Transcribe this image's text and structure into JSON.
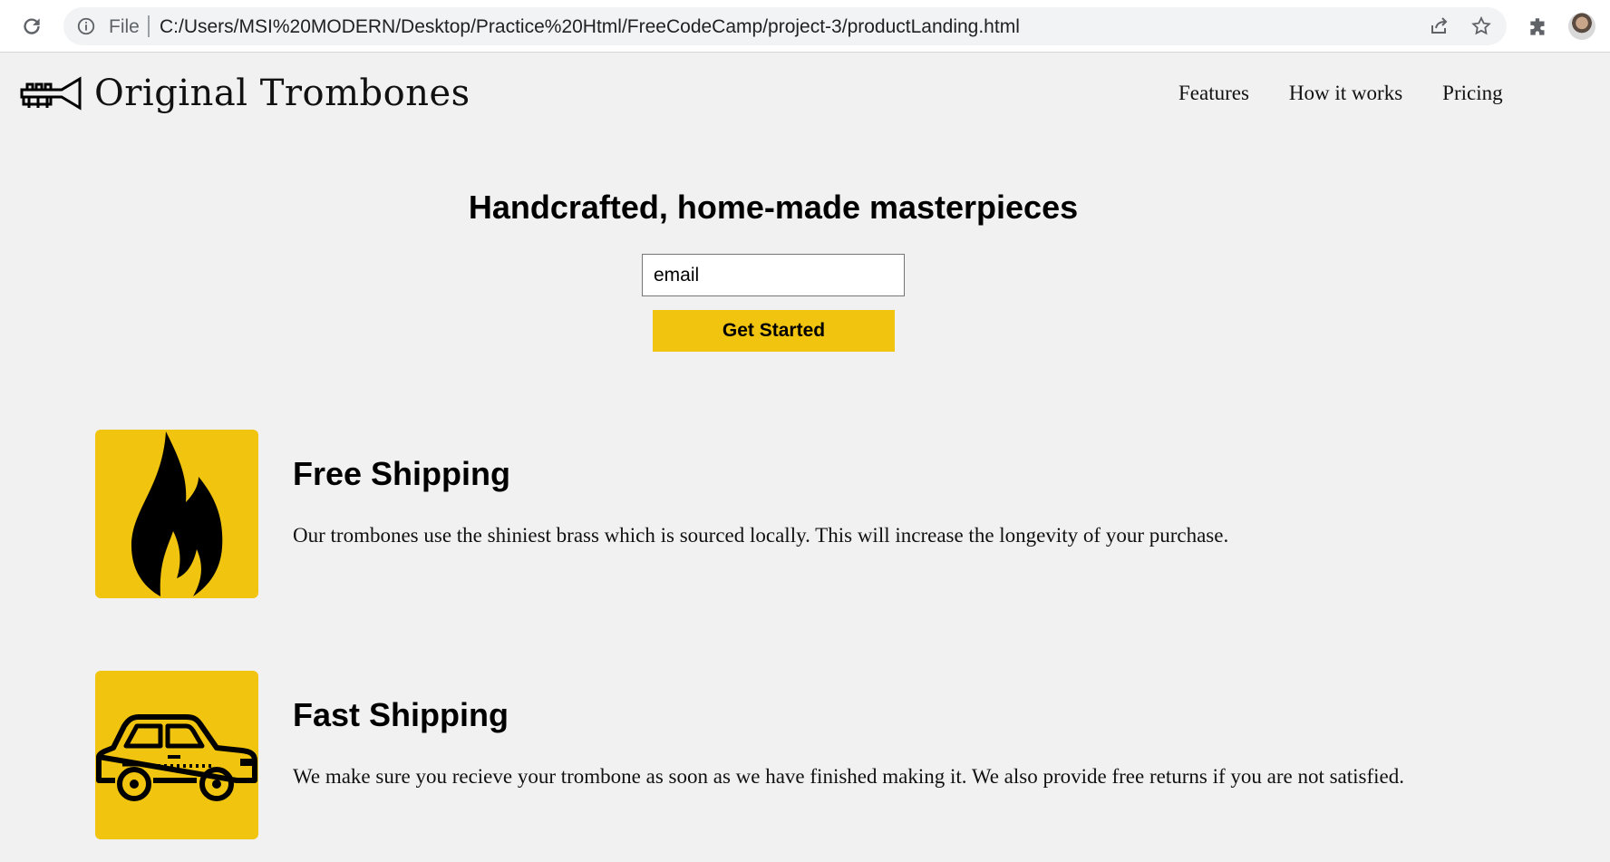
{
  "browser": {
    "file_label": "File",
    "url": "C:/Users/MSI%20MODERN/Desktop/Practice%20Html/FreeCodeCamp/project-3/productLanding.html",
    "icons": [
      "reload-icon",
      "info-icon",
      "share-icon",
      "star-icon",
      "extensions-icon",
      "profile-avatar"
    ]
  },
  "header": {
    "logo_text": "Original Trombones",
    "logo_icon": "trumpet-icon",
    "nav": [
      "Features",
      "How it works",
      "Pricing"
    ]
  },
  "hero": {
    "title": "Handcrafted, home-made masterpieces",
    "email_placeholder": "email",
    "button_label": "Get Started"
  },
  "features": [
    {
      "icon": "flame-icon",
      "title": "Free Shipping",
      "text": "Our trombones use the shiniest brass which is sourced locally. This will increase the longevity of your purchase."
    },
    {
      "icon": "car-icon",
      "title": "Fast Shipping",
      "text": "We make sure you recieve your trombone as soon as we have finished making it. We also provide free returns if you are not satisfied."
    }
  ],
  "colors": {
    "accent": "#f1c40f",
    "page_background": "#f1f1f1"
  }
}
